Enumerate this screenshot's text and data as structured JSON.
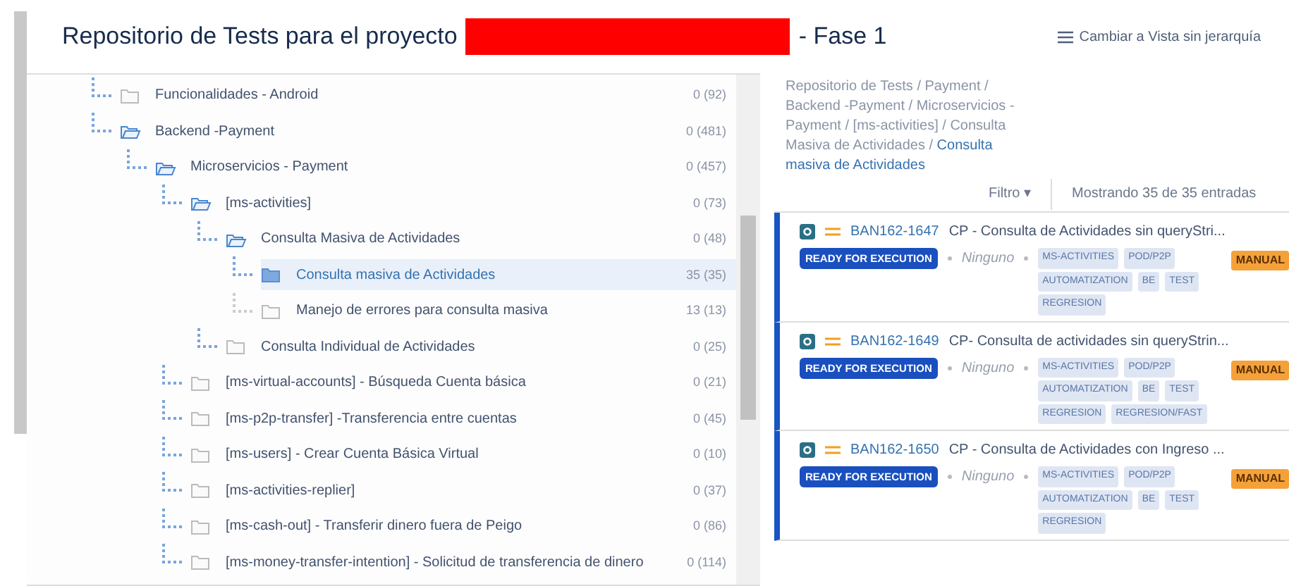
{
  "header": {
    "title_start": "Repositorio de Tests para el proyecto",
    "title_end": "- Fase 1",
    "view_toggle": "Cambiar a Vista sin jerarquía"
  },
  "tree": [
    {
      "label": "Funcionalidades - Android",
      "count": "0 (92)",
      "expanded": false,
      "selected": false
    },
    {
      "label": "Backend -Payment",
      "count": "0 (481)",
      "expanded": true,
      "selected": false,
      "children": [
        {
          "label": "Microservicios - Payment",
          "count": "0 (457)",
          "expanded": true,
          "selected": false,
          "children": [
            {
              "label": "[ms-activities]",
              "count": "0 (73)",
              "expanded": true,
              "selected": false,
              "children": [
                {
                  "label": "Consulta Masiva de Actividades",
                  "count": "0 (48)",
                  "expanded": true,
                  "selected": false,
                  "children": [
                    {
                      "label": "Consulta masiva de Actividades",
                      "count": "35 (35)",
                      "expanded": false,
                      "selected": true
                    },
                    {
                      "label": "Manejo de errores para consulta masiva",
                      "count": "13 (13)",
                      "expanded": false,
                      "selected": false
                    }
                  ]
                },
                {
                  "label": "Consulta Individual de Actividades",
                  "count": "0 (25)",
                  "expanded": false,
                  "selected": false
                }
              ]
            },
            {
              "label": "[ms-virtual-accounts] - Búsqueda Cuenta básica",
              "count": "0 (21)",
              "expanded": false,
              "selected": false
            },
            {
              "label": "[ms-p2p-transfer] -Transferencia entre cuentas",
              "count": "0 (45)",
              "expanded": false,
              "selected": false
            },
            {
              "label": "[ms-users] - Crear Cuenta Básica Virtual",
              "count": "0 (10)",
              "expanded": false,
              "selected": false
            },
            {
              "label": "[ms-activities-replier]",
              "count": "0 (37)",
              "expanded": false,
              "selected": false
            },
            {
              "label": "[ms-cash-out] - Transferir dinero fuera de Peigo",
              "count": "0 (86)",
              "expanded": false,
              "selected": false
            },
            {
              "label": "[ms-money-transfer-intention] - Solicitud de transferencia de dinero",
              "count": "0 (114)",
              "expanded": false,
              "selected": false
            }
          ]
        }
      ]
    }
  ],
  "breadcrumb": [
    {
      "label": "Repositorio de Tests / Payment / Backend -Payment / Microservicios - Payment / [ms-activities] / Consulta Masiva de Actividades /",
      "selected": false
    },
    {
      "label": "Consulta masiva de Actividades",
      "selected": true
    }
  ],
  "filter": {
    "label": "Filtro ▾",
    "summary": "Mostrando 35 de 35 entradas"
  },
  "tests": [
    {
      "key": "BAN162-1647",
      "title": "CP - Consulta de Actividades sin queryStri...",
      "type": "MANUAL",
      "status": "READY FOR EXECUTION",
      "assignee": "Ninguno",
      "labels": [
        "MS-ACTIVITIES",
        "POD/P2P",
        "AUTOMATIZATION",
        "BE",
        "TEST",
        "REGRESION"
      ]
    },
    {
      "key": "BAN162-1649",
      "title": "CP- Consulta de actividades sin queryStrin...",
      "type": "MANUAL",
      "status": "READY FOR EXECUTION",
      "assignee": "Ninguno",
      "labels": [
        "MS-ACTIVITIES",
        "POD/P2P",
        "AUTOMATIZATION",
        "BE",
        "TEST",
        "REGRESION",
        "REGRESION/FAST"
      ]
    },
    {
      "key": "BAN162-1650",
      "title": "CP - Consulta de Actividades con Ingreso ...",
      "type": "MANUAL",
      "status": "READY FOR EXECUTION",
      "assignee": "Ninguno",
      "labels": [
        "MS-ACTIVITIES",
        "POD/P2P",
        "AUTOMATIZATION",
        "BE",
        "TEST",
        "REGRESION"
      ]
    }
  ]
}
